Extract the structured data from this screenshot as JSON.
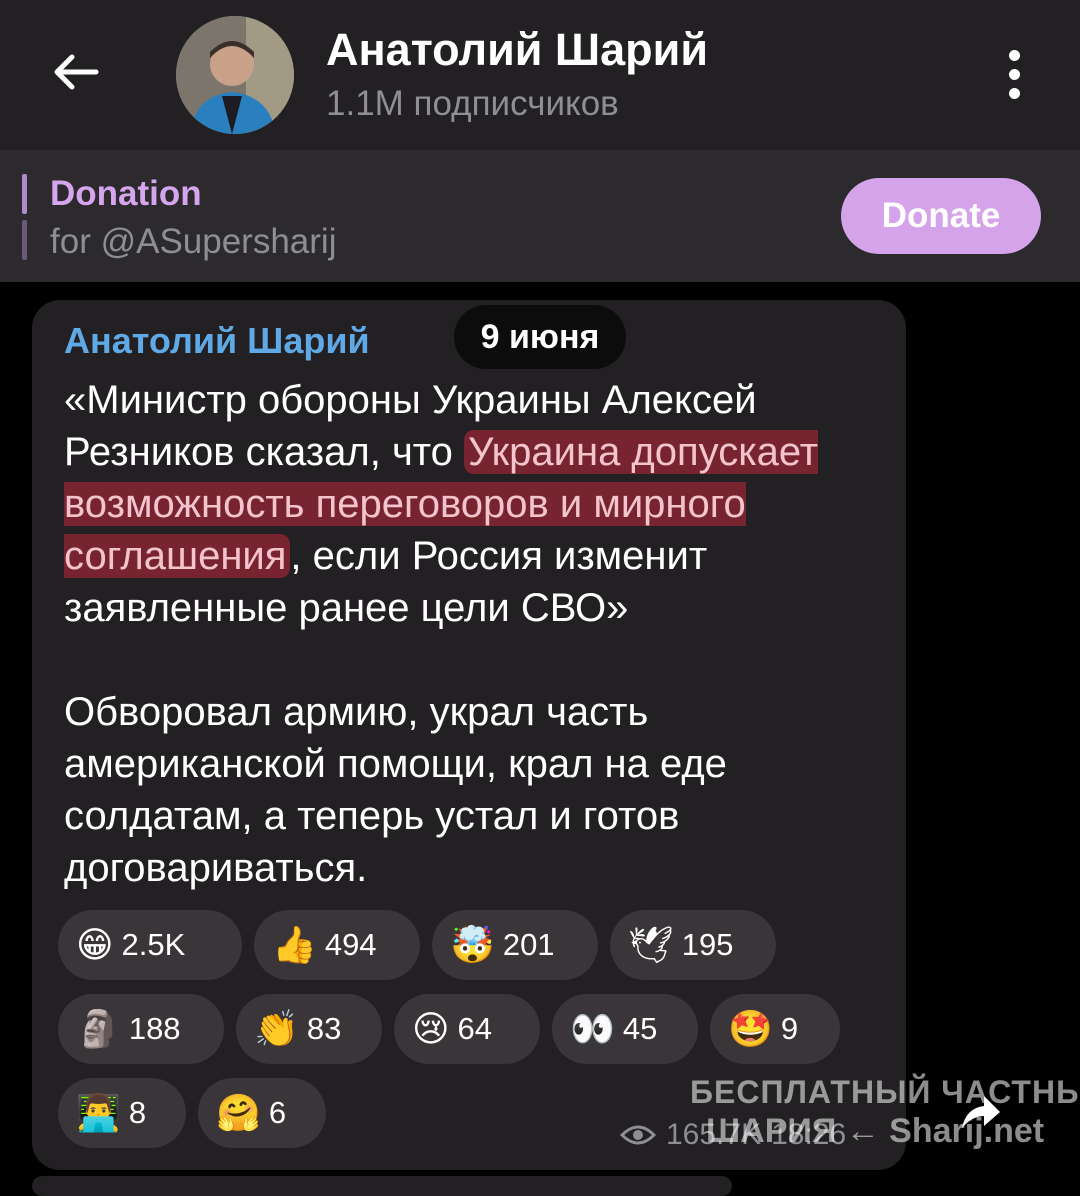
{
  "header": {
    "title": "Анатолий Шарий",
    "subtitle": "1.1M подписчиков"
  },
  "pinned": {
    "title": "Donation",
    "text": "for @ASupersharij",
    "button_label": "Donate"
  },
  "message": {
    "author": "Анатолий Шарий",
    "date": "9 июня",
    "p1_a": "«Министр обороны Украины Алексей Резников сказал, что ",
    "p1_highlight": "Украина допускает возможность переговоров и мирного соглашения",
    "p1_b": ", если Россия изменит заявленные ранее цели СВО»",
    "p2": "Обворовал армию, украл часть американской помощи, крал на еде солдатам, а теперь устал и готов договариваться.",
    "views": "165.7K",
    "time": "18:26"
  },
  "reactions": [
    {
      "emoji": "😁",
      "count": "2.5K"
    },
    {
      "emoji": "👍",
      "count": "494"
    },
    {
      "emoji": "🤯",
      "count": "201"
    },
    {
      "emoji": "🕊",
      "count": "195"
    },
    {
      "emoji": "🗿",
      "count": "188"
    },
    {
      "emoji": "👏",
      "count": "83"
    },
    {
      "emoji": "😢",
      "count": "64"
    },
    {
      "emoji": "👀",
      "count": "45"
    },
    {
      "emoji": "🤩",
      "count": "9"
    },
    {
      "emoji": "👨‍💻",
      "count": "8"
    },
    {
      "emoji": "🤗",
      "count": "6"
    }
  ],
  "watermark": {
    "line1": "БЕСПЛАТНЫЙ ЧАСТНЫЙ",
    "line2": "ШАРИЯ ← Sharij.net"
  },
  "colors": {
    "header_bg": "#222022",
    "pinned_bg": "#2c2a2d",
    "accent_purple": "#d5a3ea",
    "author_blue": "#5fa9e6",
    "bubble_bg": "#222022",
    "reaction_bg": "#3a3538"
  }
}
